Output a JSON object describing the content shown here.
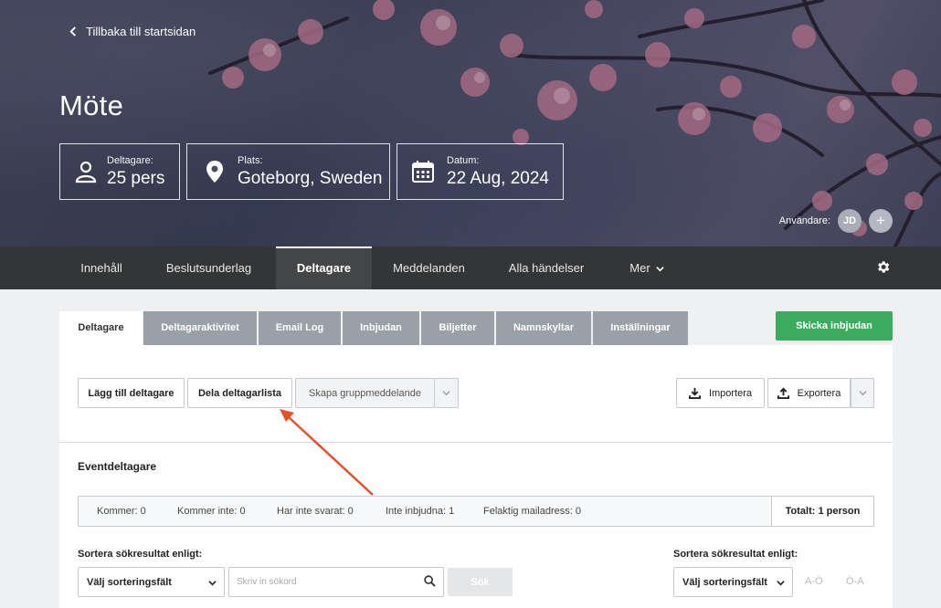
{
  "hero": {
    "back_link": "Tillbaka till startsidan",
    "title": "Möte",
    "info": {
      "participants": {
        "label": "Deltagare:",
        "value": "25 pers"
      },
      "place": {
        "label": "Plats:",
        "value": "Goteborg, Sweden"
      },
      "date": {
        "label": "Datum:",
        "value": "22 Aug, 2024"
      }
    },
    "users": {
      "label": "Användare:",
      "avatar": "JD",
      "add": "+"
    }
  },
  "nav": {
    "items": [
      "Innehåll",
      "Beslutsunderlag",
      "Deltagare",
      "Meddelanden",
      "Alla händelser",
      "Mer"
    ],
    "active": "Deltagare"
  },
  "tabs": {
    "items": [
      "Deltagare",
      "Deltagaraktivitet",
      "Email Log",
      "Inbjudan",
      "Biljetter",
      "Namnskyltar",
      "Inställningar"
    ],
    "active": "Deltagare",
    "send_button": "Skicka inbjudan"
  },
  "toolbar": {
    "add": "Lägg till deltagare",
    "share": "Dela deltagarlista",
    "group_message": "Skapa gruppmeddelande",
    "import": "Importera",
    "export": "Exportera"
  },
  "attendees": {
    "title": "Eventdeltagare",
    "stats": {
      "coming": "Kommer: 0",
      "not_coming": "Kommer inte: 0",
      "no_answer": "Har inte svarat: 0",
      "not_invited": "Inte inbjudna: 1",
      "bad_email": "Felaktig mailadress: 0",
      "total": "Totalt: 1 person"
    }
  },
  "sort": {
    "left_label": "Sortera sökresultat enligt:",
    "left_select": "Välj sorteringsfält",
    "search_placeholder": "Skriv in sökord",
    "search_button": "Sök",
    "right_label": "Sortera sökresultat enligt:",
    "right_select": "Välj sorteringsfält",
    "asc": "A-Ö",
    "desc": "Ö-A"
  },
  "colors": {
    "nav_bg": "#333536",
    "tab_inactive": "#9aa0a8",
    "send_green": "#3dab5e",
    "annotation_arrow": "#e8502a"
  },
  "icons": [
    "chevron-left-icon",
    "user-icon",
    "location-pin-icon",
    "calendar-icon",
    "chevron-down-icon",
    "gear-icon",
    "download-icon",
    "upload-icon",
    "search-icon"
  ]
}
